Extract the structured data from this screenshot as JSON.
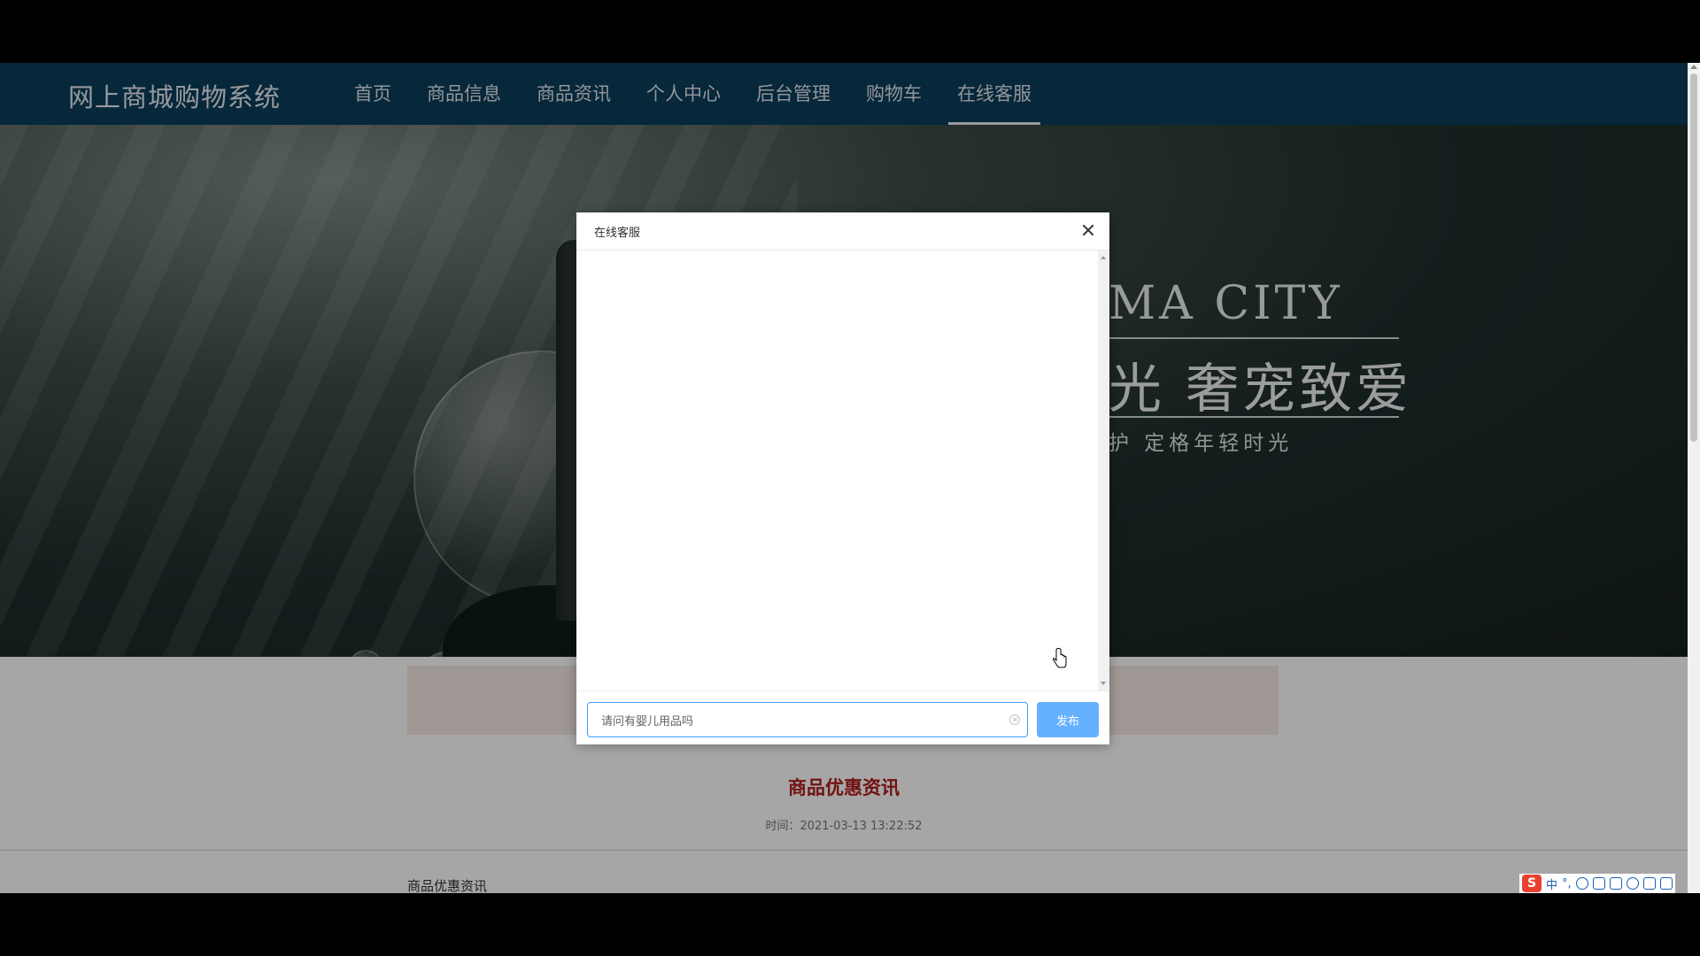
{
  "site": {
    "title": "网上商城购物系统"
  },
  "nav": {
    "items": [
      {
        "label": "首页"
      },
      {
        "label": "商品信息"
      },
      {
        "label": "商品资讯"
      },
      {
        "label": "个人中心"
      },
      {
        "label": "后台管理"
      },
      {
        "label": "购物车"
      },
      {
        "label": "在线客服",
        "active": true
      }
    ]
  },
  "banner": {
    "en_text": "MA CITY",
    "cn_text": "光 奢宠致爱",
    "sub_text": "护  定格年轻时光"
  },
  "content": {
    "news_title": "商品优惠资讯",
    "news_time": "时间：2021-03-13 13:22:52",
    "article_title": "商品优惠资讯"
  },
  "dialog": {
    "title": "在线客服",
    "input_value": "请问有婴儿用品吗",
    "send_label": "发布"
  },
  "ime": {
    "lang": "中",
    "punct": "°,"
  },
  "colors": {
    "header_bg": "#0c3c5a",
    "accent": "#409eff",
    "button": "#66b1ff",
    "news_title": "#b01c1c"
  }
}
